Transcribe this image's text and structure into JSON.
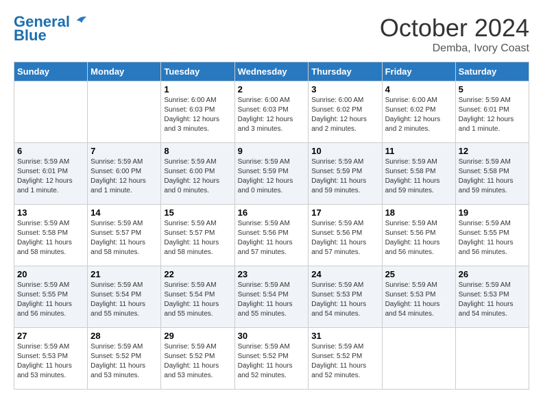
{
  "header": {
    "logo_line1": "General",
    "logo_line2": "Blue",
    "month": "October 2024",
    "location": "Demba, Ivory Coast"
  },
  "days_of_week": [
    "Sunday",
    "Monday",
    "Tuesday",
    "Wednesday",
    "Thursday",
    "Friday",
    "Saturday"
  ],
  "weeks": [
    [
      {
        "day": "",
        "info": ""
      },
      {
        "day": "",
        "info": ""
      },
      {
        "day": "1",
        "info": "Sunrise: 6:00 AM\nSunset: 6:03 PM\nDaylight: 12 hours and 3 minutes."
      },
      {
        "day": "2",
        "info": "Sunrise: 6:00 AM\nSunset: 6:03 PM\nDaylight: 12 hours and 3 minutes."
      },
      {
        "day": "3",
        "info": "Sunrise: 6:00 AM\nSunset: 6:02 PM\nDaylight: 12 hours and 2 minutes."
      },
      {
        "day": "4",
        "info": "Sunrise: 6:00 AM\nSunset: 6:02 PM\nDaylight: 12 hours and 2 minutes."
      },
      {
        "day": "5",
        "info": "Sunrise: 5:59 AM\nSunset: 6:01 PM\nDaylight: 12 hours and 1 minute."
      }
    ],
    [
      {
        "day": "6",
        "info": "Sunrise: 5:59 AM\nSunset: 6:01 PM\nDaylight: 12 hours and 1 minute."
      },
      {
        "day": "7",
        "info": "Sunrise: 5:59 AM\nSunset: 6:00 PM\nDaylight: 12 hours and 1 minute."
      },
      {
        "day": "8",
        "info": "Sunrise: 5:59 AM\nSunset: 6:00 PM\nDaylight: 12 hours and 0 minutes."
      },
      {
        "day": "9",
        "info": "Sunrise: 5:59 AM\nSunset: 5:59 PM\nDaylight: 12 hours and 0 minutes."
      },
      {
        "day": "10",
        "info": "Sunrise: 5:59 AM\nSunset: 5:59 PM\nDaylight: 11 hours and 59 minutes."
      },
      {
        "day": "11",
        "info": "Sunrise: 5:59 AM\nSunset: 5:58 PM\nDaylight: 11 hours and 59 minutes."
      },
      {
        "day": "12",
        "info": "Sunrise: 5:59 AM\nSunset: 5:58 PM\nDaylight: 11 hours and 59 minutes."
      }
    ],
    [
      {
        "day": "13",
        "info": "Sunrise: 5:59 AM\nSunset: 5:58 PM\nDaylight: 11 hours and 58 minutes."
      },
      {
        "day": "14",
        "info": "Sunrise: 5:59 AM\nSunset: 5:57 PM\nDaylight: 11 hours and 58 minutes."
      },
      {
        "day": "15",
        "info": "Sunrise: 5:59 AM\nSunset: 5:57 PM\nDaylight: 11 hours and 58 minutes."
      },
      {
        "day": "16",
        "info": "Sunrise: 5:59 AM\nSunset: 5:56 PM\nDaylight: 11 hours and 57 minutes."
      },
      {
        "day": "17",
        "info": "Sunrise: 5:59 AM\nSunset: 5:56 PM\nDaylight: 11 hours and 57 minutes."
      },
      {
        "day": "18",
        "info": "Sunrise: 5:59 AM\nSunset: 5:56 PM\nDaylight: 11 hours and 56 minutes."
      },
      {
        "day": "19",
        "info": "Sunrise: 5:59 AM\nSunset: 5:55 PM\nDaylight: 11 hours and 56 minutes."
      }
    ],
    [
      {
        "day": "20",
        "info": "Sunrise: 5:59 AM\nSunset: 5:55 PM\nDaylight: 11 hours and 56 minutes."
      },
      {
        "day": "21",
        "info": "Sunrise: 5:59 AM\nSunset: 5:54 PM\nDaylight: 11 hours and 55 minutes."
      },
      {
        "day": "22",
        "info": "Sunrise: 5:59 AM\nSunset: 5:54 PM\nDaylight: 11 hours and 55 minutes."
      },
      {
        "day": "23",
        "info": "Sunrise: 5:59 AM\nSunset: 5:54 PM\nDaylight: 11 hours and 55 minutes."
      },
      {
        "day": "24",
        "info": "Sunrise: 5:59 AM\nSunset: 5:53 PM\nDaylight: 11 hours and 54 minutes."
      },
      {
        "day": "25",
        "info": "Sunrise: 5:59 AM\nSunset: 5:53 PM\nDaylight: 11 hours and 54 minutes."
      },
      {
        "day": "26",
        "info": "Sunrise: 5:59 AM\nSunset: 5:53 PM\nDaylight: 11 hours and 54 minutes."
      }
    ],
    [
      {
        "day": "27",
        "info": "Sunrise: 5:59 AM\nSunset: 5:53 PM\nDaylight: 11 hours and 53 minutes."
      },
      {
        "day": "28",
        "info": "Sunrise: 5:59 AM\nSunset: 5:52 PM\nDaylight: 11 hours and 53 minutes."
      },
      {
        "day": "29",
        "info": "Sunrise: 5:59 AM\nSunset: 5:52 PM\nDaylight: 11 hours and 53 minutes."
      },
      {
        "day": "30",
        "info": "Sunrise: 5:59 AM\nSunset: 5:52 PM\nDaylight: 11 hours and 52 minutes."
      },
      {
        "day": "31",
        "info": "Sunrise: 5:59 AM\nSunset: 5:52 PM\nDaylight: 11 hours and 52 minutes."
      },
      {
        "day": "",
        "info": ""
      },
      {
        "day": "",
        "info": ""
      }
    ]
  ]
}
